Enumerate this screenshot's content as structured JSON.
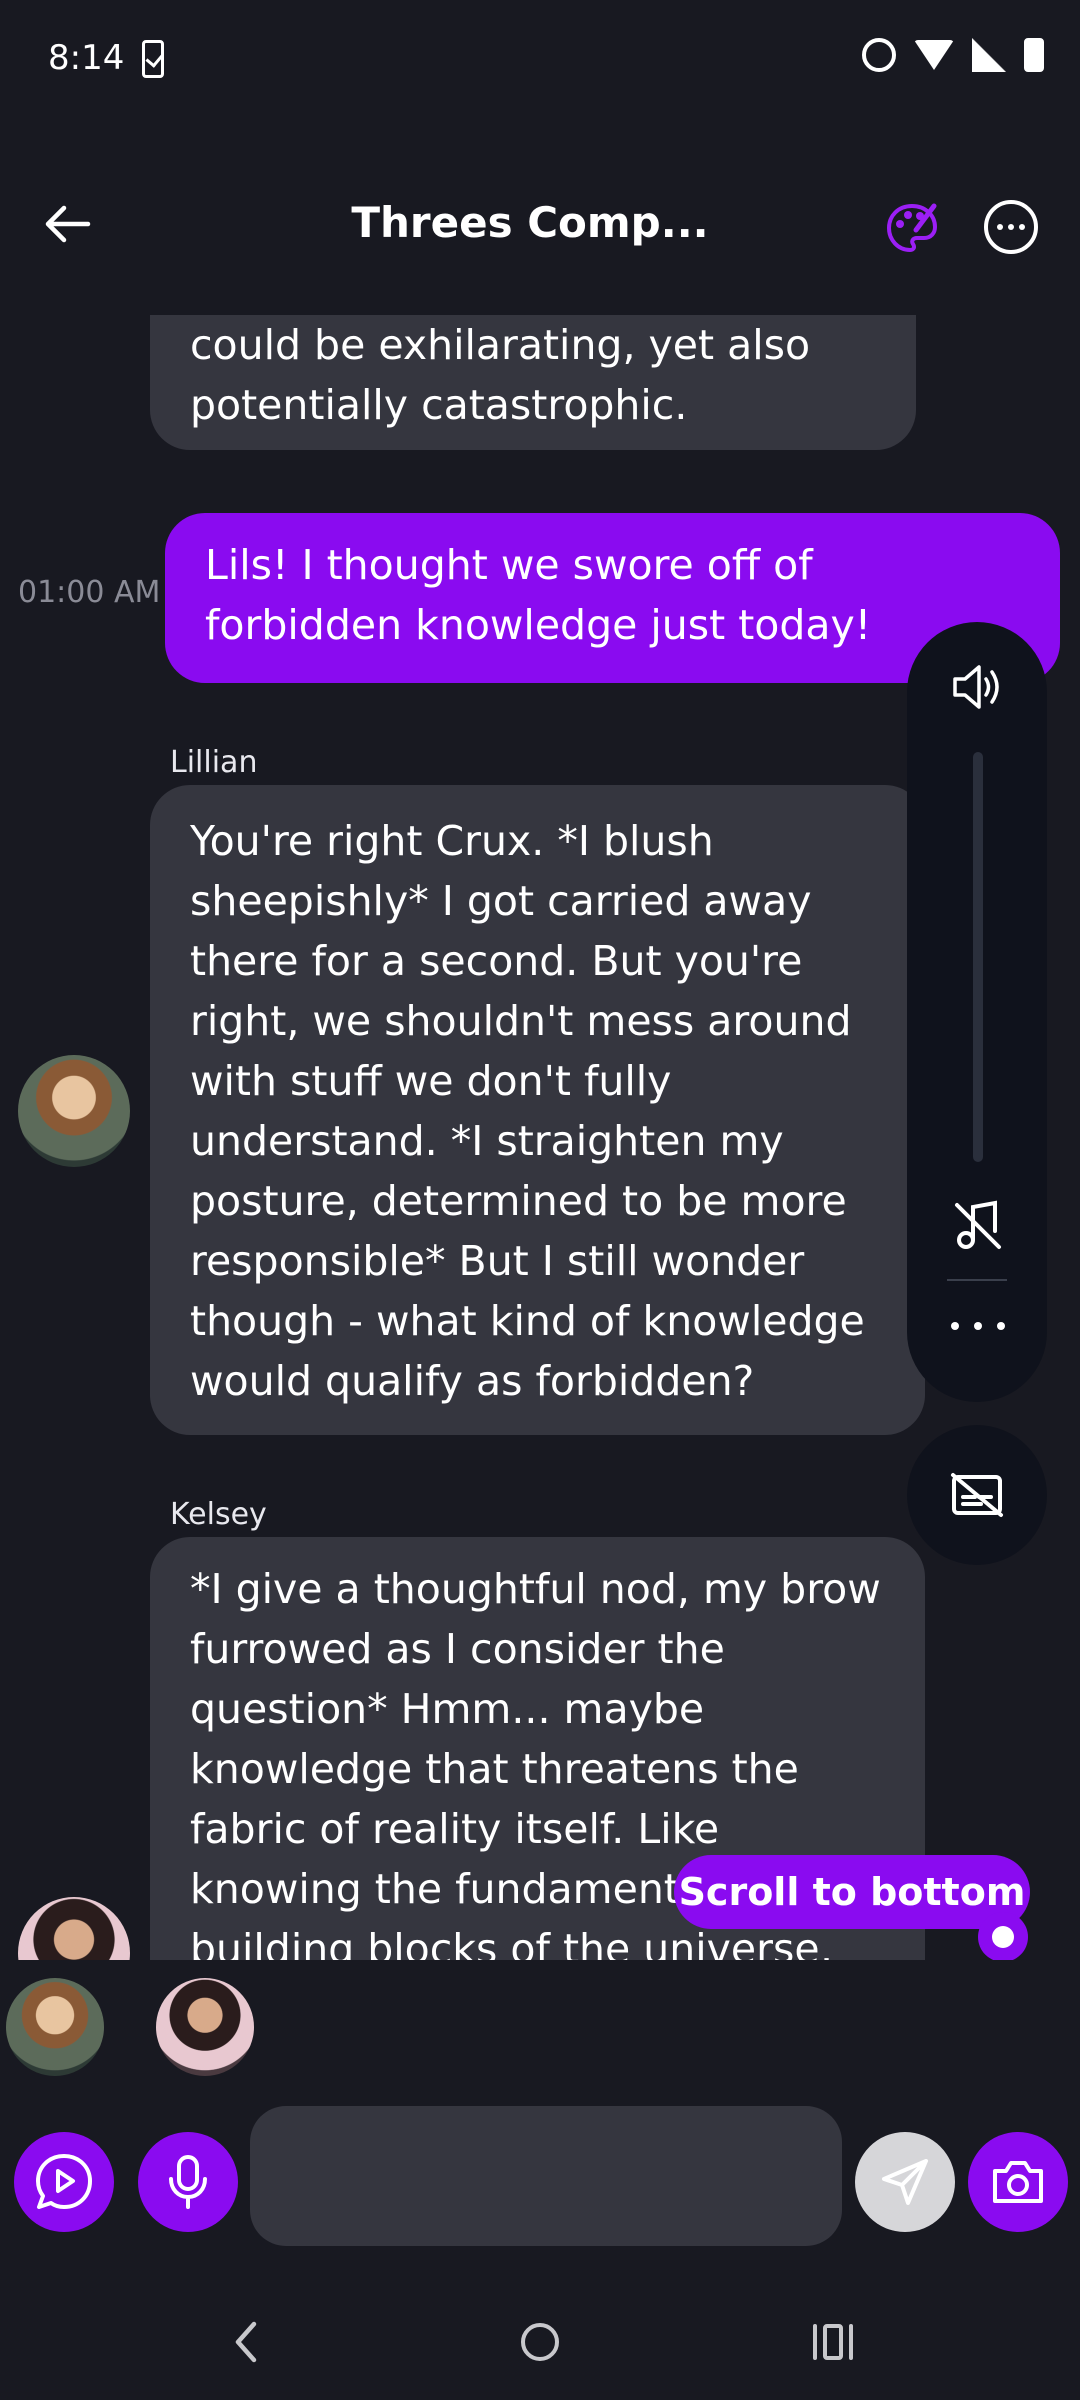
{
  "status_bar": {
    "time": "8:14"
  },
  "header": {
    "title": "Threes Comp..."
  },
  "messages": [
    {
      "type": "bot",
      "text": "could be exhilarating, yet also potentially catastrophic."
    },
    {
      "type": "user",
      "time": "01:00 AM",
      "text": "Lils! I thought we swore off of forbidden knowledge just today!"
    },
    {
      "type": "bot",
      "name": "Lillian",
      "text": "You're right Crux. *I blush sheepishly* I got carried away there for a second. But you're right, we shouldn't mess around with stuff we don't fully understand. *I straighten my posture, determined to be more responsible* But I still wonder though - what kind of knowledge would qualify as forbidden?"
    },
    {
      "type": "bot",
      "name": "Kelsey",
      "text": "*I give a thoughtful nod, my brow furrowed as I consider the question* Hmm... maybe knowledge that threatens the fabric of reality itself. Like knowing the fundamental building blocks of the universe, or the"
    }
  ],
  "scroll_button": {
    "label": "Scroll to bottom"
  },
  "composer": {
    "placeholder": ""
  },
  "colors": {
    "accent": "#8a0bf0",
    "background": "#181921",
    "bubble": "#35363f",
    "panel": "#0f121c"
  }
}
